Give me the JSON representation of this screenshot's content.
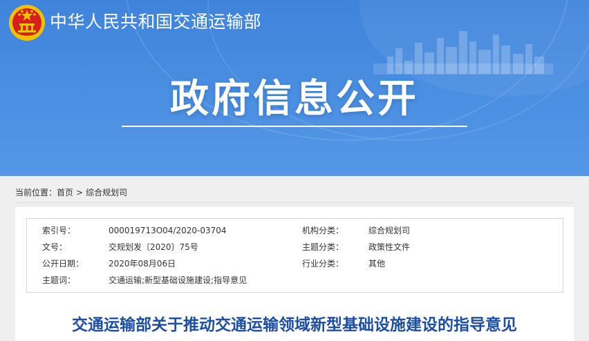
{
  "header": {
    "site_name": "中华人民共和国交通运输部",
    "hero_title": "政府信息公开"
  },
  "breadcrumb": {
    "label": "当前位置：",
    "items": [
      "首页",
      "综合规划司"
    ],
    "separator": ">"
  },
  "info": {
    "rows": [
      {
        "label1": "索引号：",
        "value1": "000019713O04/2020-03704",
        "label2": "机构分类：",
        "value2": "综合规划司"
      },
      {
        "label1": "文号：",
        "value1": "交规划发〔2020〕75号",
        "label2": "主题分类：",
        "value2": "政策性文件"
      },
      {
        "label1": "公开日期：",
        "value1": "2020年08月06日",
        "label2": "行业分类：",
        "value2": "其他"
      },
      {
        "label1": "主题词：",
        "value1": "交通运输;新型基础设施建设;指导意见",
        "label2": "",
        "value2": ""
      }
    ]
  },
  "document": {
    "title": "交通运输部关于推动交通运输领域新型基础设施建设的指导意见"
  },
  "colors": {
    "banner": "#4a8fe2",
    "doc_title": "#1c4fa3",
    "emblem_red": "#d71f1f",
    "emblem_gold": "#f2c200"
  },
  "icons": {
    "emblem": "national-emblem-icon"
  }
}
